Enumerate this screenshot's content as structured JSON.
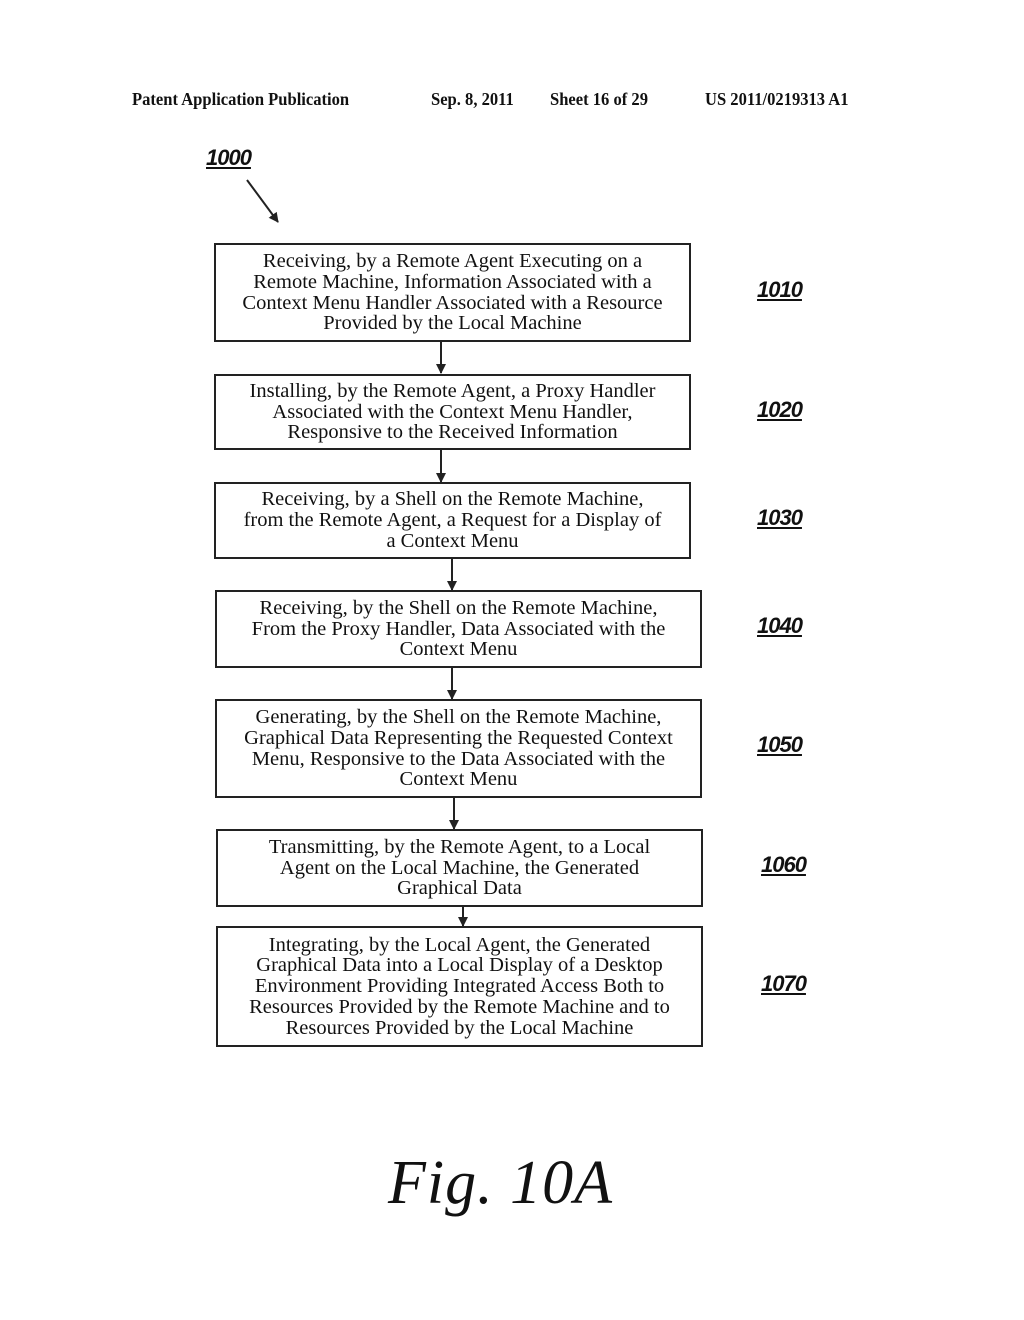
{
  "header": {
    "publication_type": "Patent Application Publication",
    "date": "Sep. 8, 2011",
    "sheet": "Sheet 16 of 29",
    "publication_number": "US 2011/0219313 A1"
  },
  "figure": {
    "reference": "1000",
    "caption": "Fig. 10A"
  },
  "steps": [
    {
      "id": "1010",
      "text": "Receiving, by a Remote Agent Executing on a\nRemote Machine, Information Associated with a\nContext Menu Handler Associated with a Resource\nProvided by the Local Machine"
    },
    {
      "id": "1020",
      "text": "Installing, by the Remote Agent, a Proxy Handler\nAssociated with the Context Menu Handler,\nResponsive to the Received Information"
    },
    {
      "id": "1030",
      "text": "Receiving, by a Shell on the Remote Machine,\nfrom the Remote Agent, a Request for a Display of\na Context Menu"
    },
    {
      "id": "1040",
      "text": "Receiving, by the Shell on the Remote Machine,\nFrom the Proxy Handler, Data Associated with the\nContext Menu"
    },
    {
      "id": "1050",
      "text": "Generating, by the Shell on the Remote Machine,\nGraphical Data Representing the Requested Context\nMenu, Responsive to the Data Associated with the\nContext Menu"
    },
    {
      "id": "1060",
      "text": "Transmitting, by the Remote Agent, to a Local\nAgent on the Local Machine, the Generated\nGraphical Data"
    },
    {
      "id": "1070",
      "text": "Integrating, by the Local Agent, the Generated\nGraphical Data into a Local Display of a Desktop\nEnvironment Providing Integrated Access Both to\nResources Provided by the Remote Machine and to\nResources Provided by the Local Machine"
    }
  ],
  "flow": [
    "1010",
    "1020",
    "1030",
    "1040",
    "1050",
    "1060",
    "1070"
  ]
}
